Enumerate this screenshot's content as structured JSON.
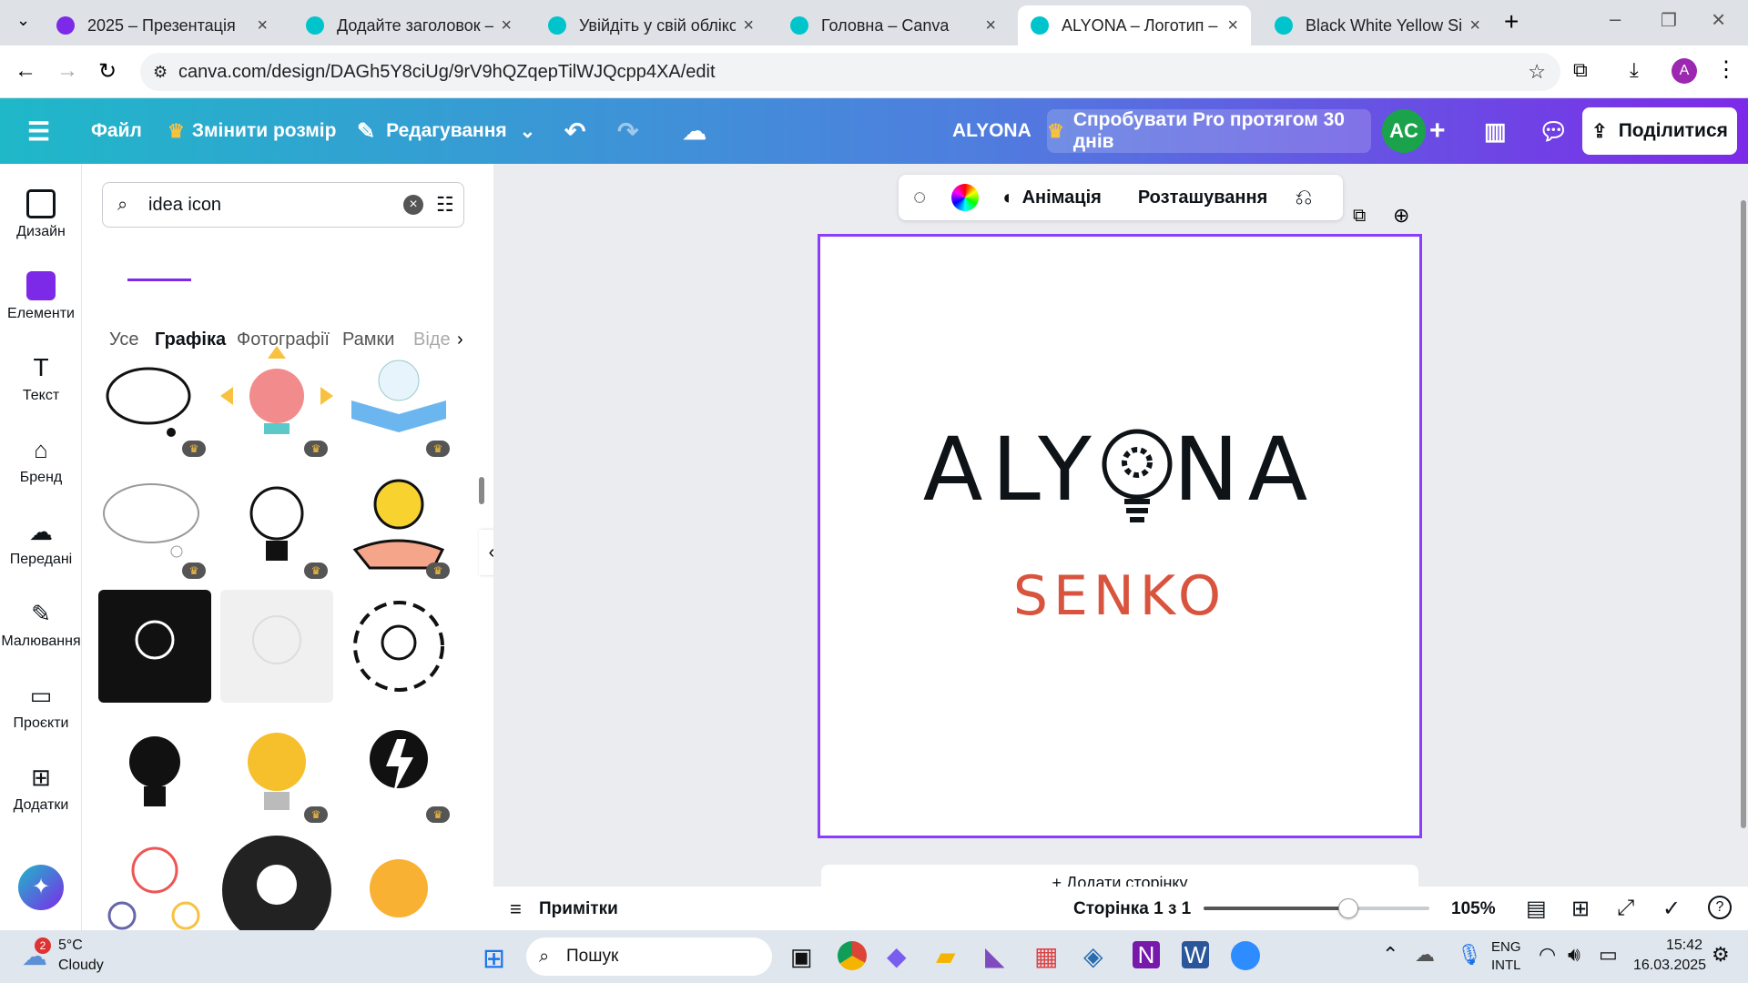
{
  "browser": {
    "tabs": [
      {
        "title": "2025 – Презентація",
        "active": false,
        "color": "#7d2ae8"
      },
      {
        "title": "Додайте заголовок – Лого",
        "active": false,
        "color": "#00c4cc"
      },
      {
        "title": "Увійдіть у свій обліковий",
        "active": false,
        "color": "#00c4cc"
      },
      {
        "title": "Головна – Canva",
        "active": false,
        "color": "#00c4cc"
      },
      {
        "title": "ALYONA – Логотип – Canv",
        "active": true,
        "color": "#00c4cc"
      },
      {
        "title": "Black White Yellow Simple",
        "active": false,
        "color": "#00c4cc"
      }
    ],
    "url": "canva.com/design/DAGh5Y8ciUg/9rV9hQZqepTilWJQcpp4XA/edit"
  },
  "header": {
    "file": "Файл",
    "resize": "Змінити розмір",
    "editing": "Редагування",
    "design_title": "ALYONA",
    "pro_trial": "Спробувати Pro протягом 30 днів",
    "avatar": "AC",
    "share": "Поділитися"
  },
  "rail": [
    {
      "label": "Дизайн",
      "icon": "layout-icon"
    },
    {
      "label": "Елементи",
      "icon": "elements-icon"
    },
    {
      "label": "Текст",
      "icon": "text-icon"
    },
    {
      "label": "Бренд",
      "icon": "brand-icon"
    },
    {
      "label": "Передані",
      "icon": "uploads-icon"
    },
    {
      "label": "Малювання",
      "icon": "draw-icon"
    },
    {
      "label": "Проєкти",
      "icon": "folder-icon"
    },
    {
      "label": "Додатки",
      "icon": "apps-icon"
    }
  ],
  "panel": {
    "search_value": "idea icon",
    "filters": [
      "Усе",
      "Графіка",
      "Фотографії",
      "Рамки",
      "Віде"
    ]
  },
  "context_toolbar": {
    "animation": "Анімація",
    "position": "Розташування"
  },
  "canvas": {
    "title_part1": "ALY",
    "title_part2": "NA",
    "subtitle": "SENKO",
    "add_page": "+ Додати сторінку"
  },
  "bottom": {
    "notes": "Примітки",
    "page_indicator": "Сторінка 1 з 1",
    "zoom": "105%",
    "zoom_fraction": 0.64
  },
  "taskbar": {
    "weather_temp": "5°C",
    "weather_desc": "Cloudy",
    "weather_badge": "2",
    "search": "Пошук",
    "lang1": "ENG",
    "lang2": "INTL",
    "time": "15:42",
    "date": "16.03.2025"
  }
}
